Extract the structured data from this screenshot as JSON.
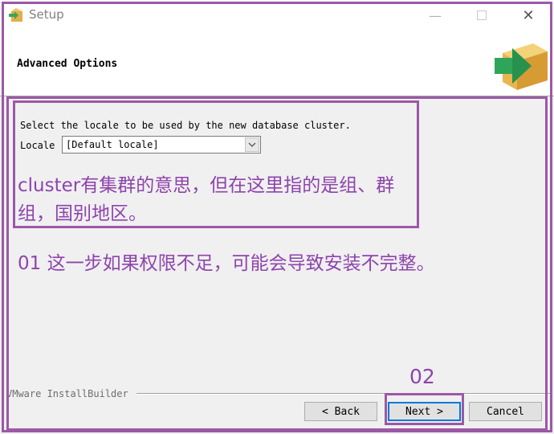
{
  "window": {
    "title": "Setup",
    "minimize_glyph": "—",
    "close_glyph": "✕"
  },
  "header": {
    "title": "Advanced Options",
    "logo_icon": "installer-arrow-box-icon"
  },
  "content": {
    "description": "Select the locale to be used by the new database cluster.",
    "locale_label": "Locale",
    "locale_value": "[Default locale]"
  },
  "annotations": {
    "note_1": "cluster有集群的意思，但在这里指的是组、群组，国别地区。",
    "note_2": "01 这一步如果权限不足，可能会导致安装不完整。",
    "label_02": "02",
    "color": "#8e44ad"
  },
  "footer": {
    "branding": "VMware InstallBuilder",
    "back_label": "< Back",
    "next_label": "Next >",
    "cancel_label": "Cancel"
  }
}
